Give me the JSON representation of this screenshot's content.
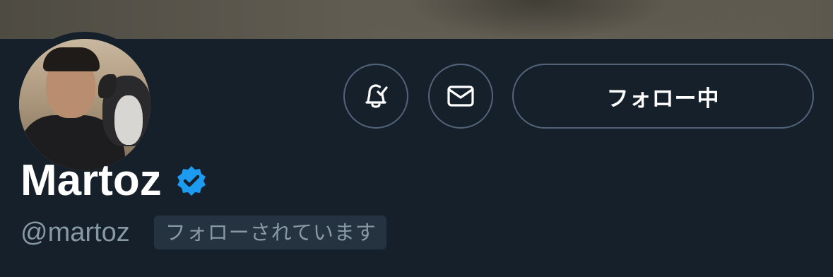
{
  "profile": {
    "display_name": "Martoz",
    "handle": "@martoz",
    "follows_you_label": "フォローされています",
    "verified": true
  },
  "actions": {
    "follow_label": "フォロー中",
    "notify_icon": "bell-check-icon",
    "message_icon": "envelope-icon"
  },
  "colors": {
    "background": "#15202b",
    "verified": "#1d9bf0",
    "muted_text": "#8899a6",
    "border": "#53647a",
    "badge_bg": "#253341"
  }
}
